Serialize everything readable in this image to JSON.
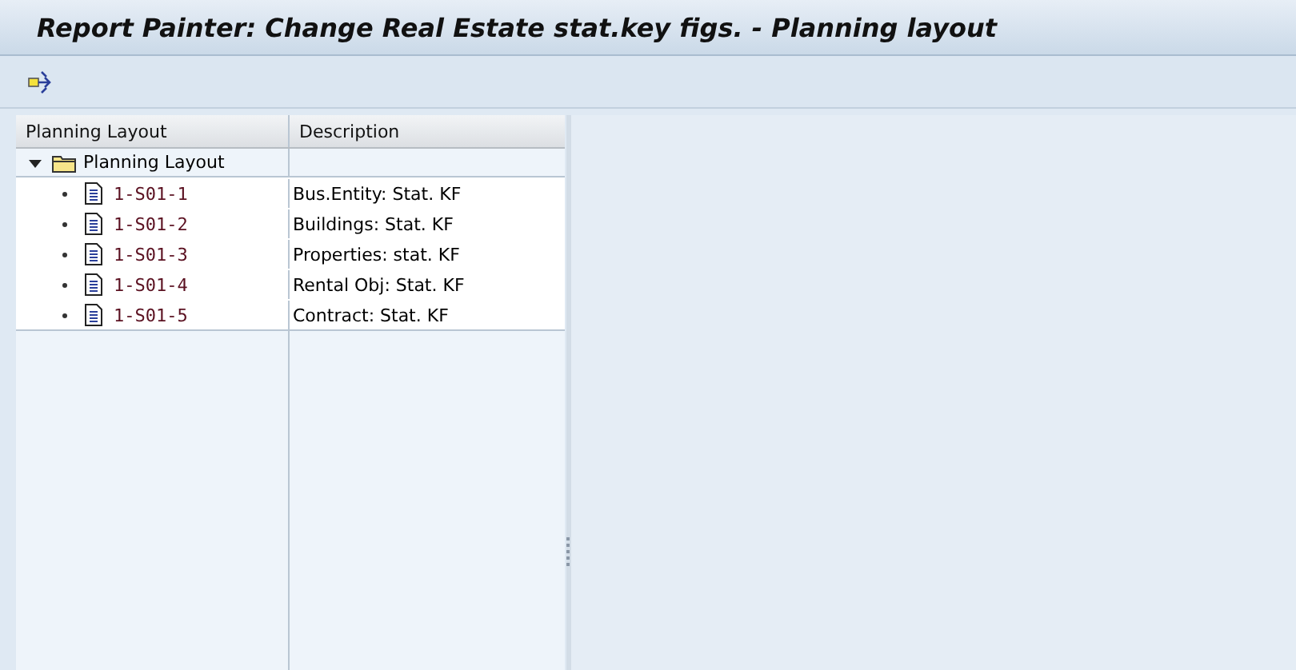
{
  "window": {
    "title": "Report Painter: Change Real Estate stat.key figs. - Planning layout"
  },
  "tree": {
    "columns": [
      "Planning Layout",
      "Description"
    ],
    "root": {
      "label": "Planning Layout",
      "expanded": true,
      "children": [
        {
          "label": "1-S01-1",
          "description": "Bus.Entity: Stat. KF"
        },
        {
          "label": "1-S01-2",
          "description": "Buildings: Stat. KF"
        },
        {
          "label": "1-S01-3",
          "description": "Properties: stat. KF"
        },
        {
          "label": "1-S01-4",
          "description": "Rental Obj: Stat. KF"
        },
        {
          "label": "1-S01-5",
          "description": "Contract: Stat. KF"
        }
      ]
    }
  }
}
